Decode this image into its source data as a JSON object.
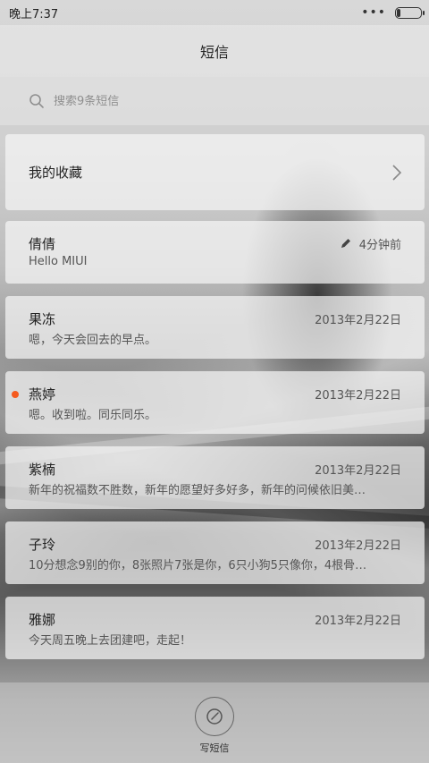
{
  "status_bar": {
    "time": "晚上7:37",
    "overflow": "•••",
    "battery_icon": "battery-icon"
  },
  "header": {
    "title": "短信"
  },
  "search": {
    "placeholder": "搜索9条短信",
    "value": ""
  },
  "favorites": {
    "label": "我的收藏",
    "icon": "chevron-right-icon"
  },
  "threads": [
    {
      "name": "倩倩",
      "time": "4分钟前",
      "preview": "Hello MIUI",
      "draft": true,
      "unread": false
    },
    {
      "name": "果冻",
      "time": "2013年2月22日",
      "preview": "嗯，今天会回去的早点。",
      "draft": false,
      "unread": false
    },
    {
      "name": "燕婷",
      "time": "2013年2月22日",
      "preview": "嗯。收到啦。同乐同乐。",
      "draft": false,
      "unread": true
    },
    {
      "name": "紫楠",
      "time": "2013年2月22日",
      "preview": "新年的祝福数不胜数，新年的愿望好多好多，新年的问候依旧美…",
      "draft": false,
      "unread": false
    },
    {
      "name": "子玲",
      "time": "2013年2月22日",
      "preview": "10分想念9别的你，8张照片7张是你，6只小狗5只像你，4根骨…",
      "draft": false,
      "unread": false
    },
    {
      "name": "雅娜",
      "time": "2013年2月22日",
      "preview": "今天周五晚上去团建吧，走起！",
      "draft": false,
      "unread": false
    }
  ],
  "bottom": {
    "compose_label": "写短信",
    "compose_icon": "compose-icon"
  },
  "colors": {
    "unread_dot": "#f55a1e",
    "text_primary": "#222222",
    "text_secondary": "#555555"
  }
}
